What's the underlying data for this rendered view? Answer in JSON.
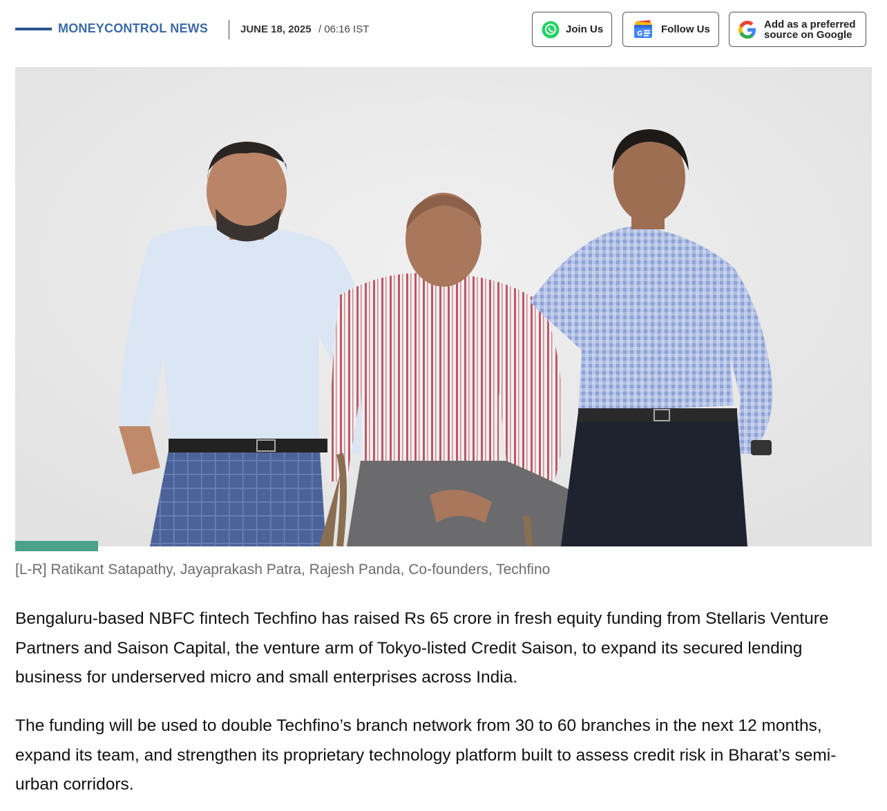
{
  "header": {
    "brand": "MONEYCONTROL NEWS",
    "date": "JUNE 18, 2025",
    "time": "/ 06:16 IST",
    "join_label": "Join Us",
    "follow_label": "Follow Us",
    "google_line1": "Add as a preferred",
    "google_line2": "source on Google"
  },
  "article": {
    "photo_alt": "[L-R] Ratikant Satapathy, Jayaprakash Patra, Rajesh Panda, Co-founders, Techfino",
    "caption": "[L-R] Ratikant Satapathy, Jayaprakash Patra, Rajesh Panda, Co-founders, Techfino",
    "paragraphs": [
      "Bengaluru-based NBFC fintech Techfino has raised Rs 65 crore in fresh equity funding from Stellaris Venture Partners and Saison Capital, the venture arm of Tokyo-listed Credit Saison, to expand its secured lending business for underserved micro and small enterprises across India.",
      "The funding will be used to double Techfino’s branch network from 30 to 60 branches in the next 12 months, expand its team, and strengthen its proprietary technology platform built to assess credit risk in Bharat’s semi-urban corridors."
    ]
  },
  "colors": {
    "brand": "#3c6aa6",
    "accent": "#4aa389",
    "whatsapp": "#25d366"
  },
  "icons": [
    "whatsapp-icon",
    "google-news-icon",
    "google-icon"
  ]
}
